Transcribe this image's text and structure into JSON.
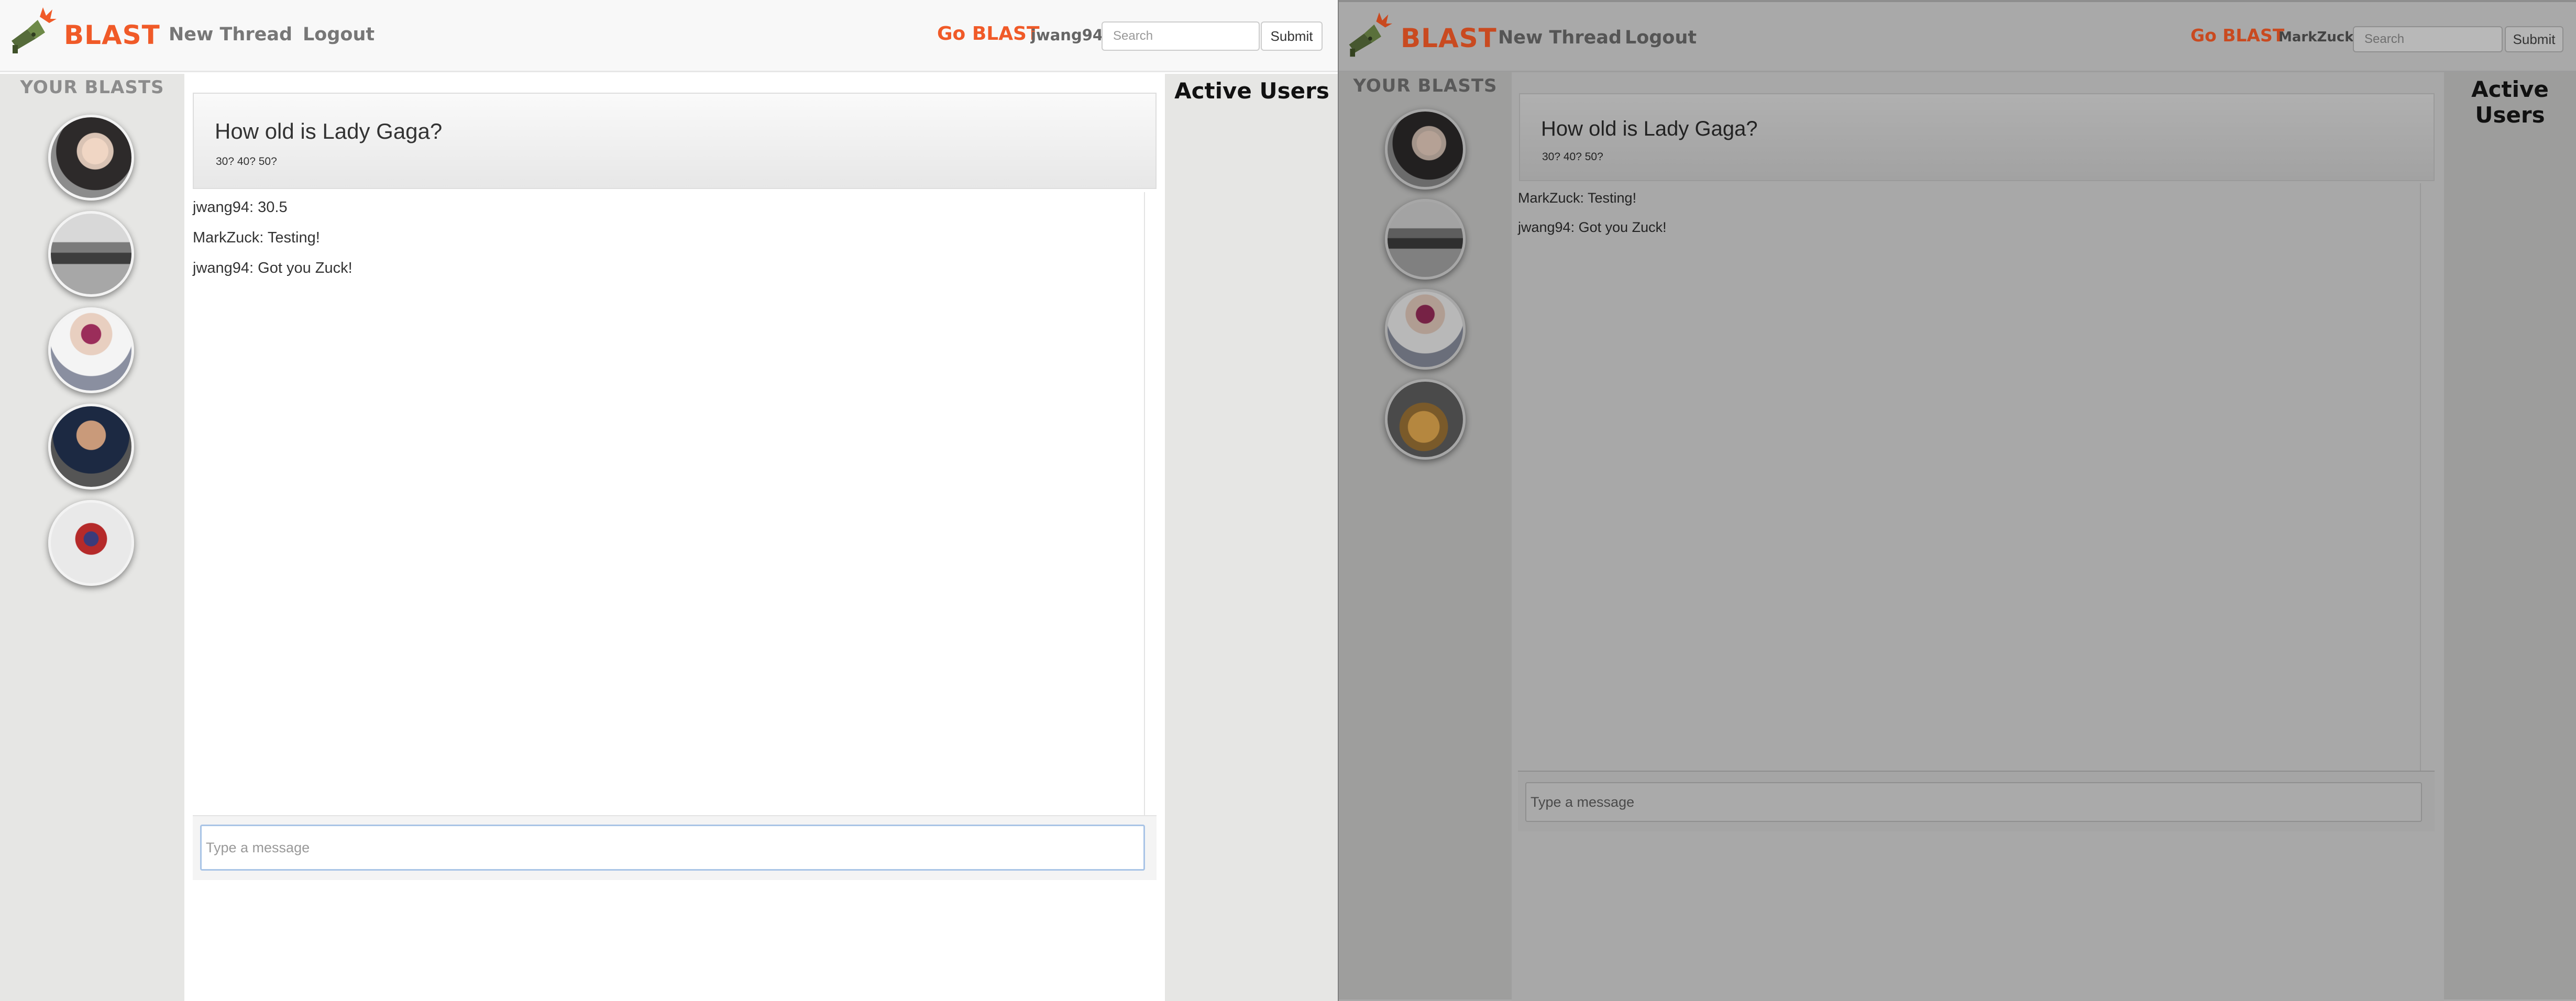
{
  "left": {
    "brand": "BLAST",
    "nav": {
      "new_thread": "New Thread",
      "logout": "Logout"
    },
    "go_blast": "Go BLAST",
    "username": "jwang94",
    "search": {
      "placeholder": "Search"
    },
    "submit_label": "Submit",
    "sidebar_title": "YOUR BLASTS",
    "avatars": [
      "lady-gaga-avatar",
      "car-avatar",
      "portrait-avatar",
      "jeff-bezos-avatar",
      "anime-character-avatar"
    ],
    "thread": {
      "title": "How old is Lady Gaga?",
      "subtitle": "30? 40? 50?"
    },
    "messages": [
      "jwang94: 30.5",
      "MarkZuck: Testing!",
      "jwang94: Got you Zuck!"
    ],
    "composer": {
      "placeholder": "Type a message"
    },
    "active_users_title": "Active Users"
  },
  "right": {
    "brand": "BLAST",
    "nav": {
      "new_thread": "New Thread",
      "logout": "Logout"
    },
    "go_blast": "Go BLAST",
    "username": "MarkZuck",
    "search": {
      "placeholder": "Search"
    },
    "submit_label": "Submit",
    "sidebar_title": "YOUR BLASTS",
    "avatars": [
      "lady-gaga-avatar",
      "car-avatar",
      "portrait-avatar",
      "food-avatar"
    ],
    "thread": {
      "title": "How old is Lady Gaga?",
      "subtitle": "30? 40? 50?"
    },
    "messages": [
      "MarkZuck: Testing!",
      "jwang94: Got you Zuck!"
    ],
    "composer": {
      "placeholder": "Type a message"
    },
    "active_users_title": "Active Users"
  },
  "colors": {
    "brand_orange": "#f05a28",
    "sidebar_gray": "#e6e6e4",
    "overlay_gray": "#a9a9a9"
  }
}
